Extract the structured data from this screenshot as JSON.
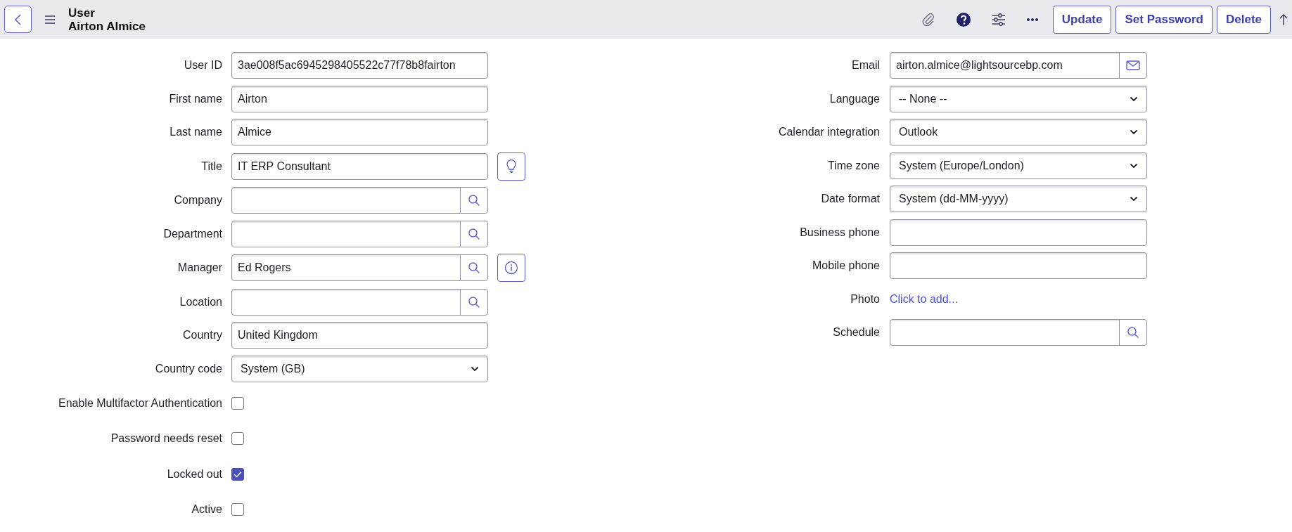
{
  "header": {
    "record_type": "User",
    "record_name": "Airton Almice",
    "buttons": [
      "Update",
      "Set Password",
      "Delete"
    ]
  },
  "left_fields": [
    {
      "label": "User ID",
      "kind": "text",
      "value": "3ae008f5ac6945298405522c77f78b8fairton"
    },
    {
      "label": "First name",
      "kind": "text",
      "value": "Airton"
    },
    {
      "label": "Last name",
      "kind": "text",
      "value": "Almice"
    },
    {
      "label": "Title",
      "kind": "text",
      "value": "IT ERP Consultant",
      "side_button": {
        "kind": "suggestion"
      }
    },
    {
      "label": "Company",
      "kind": "reference"
    },
    {
      "label": "Department",
      "kind": "reference"
    },
    {
      "label": "Manager",
      "kind": "reference",
      "value": "Ed Rogers",
      "side_button": {
        "kind": "info"
      }
    },
    {
      "label": "Location",
      "kind": "reference"
    },
    {
      "label": "Country",
      "kind": "text",
      "value": "United Kingdom"
    },
    {
      "label": "Country code",
      "kind": "select",
      "value": "System (GB)"
    }
  ],
  "checkboxes": [
    {
      "label": "Enable Multifactor Authentication",
      "checked": false
    },
    {
      "label": "Password needs reset",
      "checked": false
    },
    {
      "label": "Locked out",
      "checked": true
    },
    {
      "label": "Active",
      "checked": false
    }
  ],
  "right_fields": [
    {
      "label": "Email",
      "kind": "email",
      "value": "airton.almice@lightsourcebp.com"
    },
    {
      "label": "Language",
      "kind": "select",
      "value": "-- None --"
    },
    {
      "label": "Calendar integration",
      "kind": "select",
      "value": "Outlook"
    },
    {
      "label": "Time zone",
      "kind": "select",
      "value": "System (Europe/London)"
    },
    {
      "label": "Date format",
      "kind": "select",
      "value": "System (dd-MM-yyyy)"
    },
    {
      "label": "Business phone",
      "kind": "text"
    },
    {
      "label": "Mobile phone",
      "kind": "text"
    },
    {
      "label": "Photo",
      "kind": "link",
      "value": "Click to add..."
    },
    {
      "label": "Schedule",
      "kind": "reference"
    }
  ]
}
